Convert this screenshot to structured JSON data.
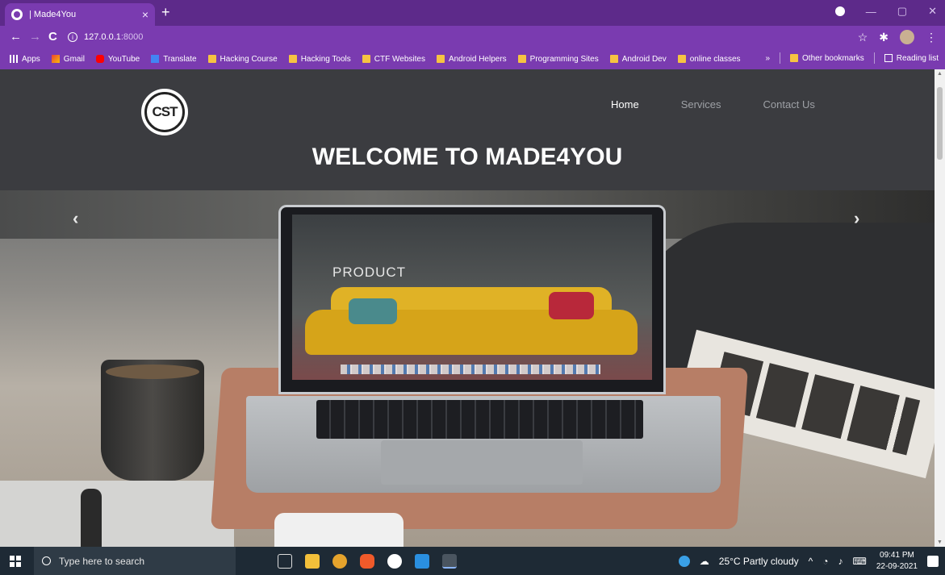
{
  "browser": {
    "tab_title": "| Made4You",
    "tab_close": "×",
    "new_tab": "+",
    "url_host": "127.0.0.1",
    "url_port": ":8000",
    "bookmarks": [
      {
        "label": "Apps",
        "icon": "apps-icon"
      },
      {
        "label": "Gmail",
        "icon": "gmail-icon"
      },
      {
        "label": "YouTube",
        "icon": "youtube-icon"
      },
      {
        "label": "Translate",
        "icon": "translate-icon"
      },
      {
        "label": "Hacking Course",
        "icon": "folder-icon"
      },
      {
        "label": "Hacking Tools",
        "icon": "folder-icon"
      },
      {
        "label": "CTF Websites",
        "icon": "folder-icon"
      },
      {
        "label": "Android Helpers",
        "icon": "folder-icon"
      },
      {
        "label": "Programming Sites",
        "icon": "folder-icon"
      },
      {
        "label": "Android Dev",
        "icon": "folder-icon"
      },
      {
        "label": "online classes",
        "icon": "folder-icon"
      }
    ],
    "overflow": "»",
    "other_bookmarks": "Other bookmarks",
    "reading_list": "Reading list"
  },
  "page": {
    "logo_text": "CST",
    "nav": [
      {
        "label": "Home",
        "active": true
      },
      {
        "label": "Services",
        "active": false
      },
      {
        "label": "Contact Us",
        "active": false
      }
    ],
    "welcome": "WELCOME TO MADE4YOU",
    "carousel_screen_text": "PRODUCT",
    "prev_arrow": "‹",
    "next_arrow": "›"
  },
  "taskbar": {
    "search_placeholder": "Type here to search",
    "weather": "25°C  Partly cloudy",
    "time": "09:41 PM",
    "date": "22-09-2021"
  },
  "colors": {
    "tab_bar": "#5d2a8a",
    "toolbar": "#7a3bb0",
    "page_header": "#3b3c40",
    "taskbar": "#1e2a35"
  }
}
